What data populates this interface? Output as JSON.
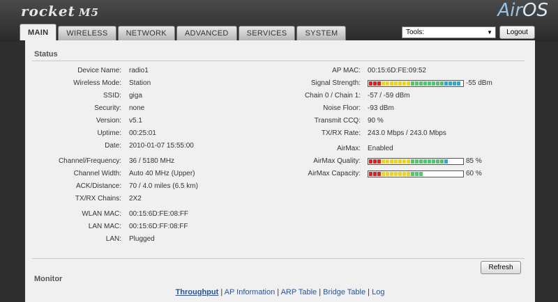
{
  "header": {
    "logo": "rocket",
    "model": "M5",
    "brand_air": "Air",
    "brand_os": "OS"
  },
  "tabs": [
    {
      "label": "MAIN"
    },
    {
      "label": "WIRELESS"
    },
    {
      "label": "NETWORK"
    },
    {
      "label": "ADVANCED"
    },
    {
      "label": "SERVICES"
    },
    {
      "label": "SYSTEM"
    }
  ],
  "tools": {
    "selected": "Tools:"
  },
  "logout_label": "Logout",
  "status": {
    "title": "Status",
    "left": [
      {
        "label": "Device Name:",
        "value": "radio1"
      },
      {
        "label": "Wireless Mode:",
        "value": "Station"
      },
      {
        "label": "SSID:",
        "value": "giga"
      },
      {
        "label": "Security:",
        "value": "none"
      },
      {
        "label": "Version:",
        "value": "v5.1"
      },
      {
        "label": "Uptime:",
        "value": "00:25:01"
      },
      {
        "label": "Date:",
        "value": "2010-01-07 15:55:00"
      },
      {
        "label": "Channel/Frequency:",
        "value": "36 / 5180 MHz"
      },
      {
        "label": "Channel Width:",
        "value": "Auto 40 MHz (Upper)"
      },
      {
        "label": "ACK/Distance:",
        "value": "70 / 4.0 miles (6.5 km)"
      },
      {
        "label": "TX/RX Chains:",
        "value": "2X2"
      },
      {
        "label": "WLAN MAC:",
        "value": "00:15:6D:FE:08:FF"
      },
      {
        "label": "LAN MAC:",
        "value": "00:15:6D:FF:08:FF"
      },
      {
        "label": "LAN:",
        "value": "Plugged"
      }
    ],
    "right": [
      {
        "label": "AP MAC:",
        "value": "00:15:6D:FE:09:52"
      },
      {
        "label": "Signal Strength:",
        "value": "-55 dBm",
        "level": 1.0
      },
      {
        "label": "Chain 0 / Chain 1:",
        "value": "-57 / -59 dBm"
      },
      {
        "label": "Noise Floor:",
        "value": "-93 dBm"
      },
      {
        "label": "Transmit CCQ:",
        "value": "90 %"
      },
      {
        "label": "TX/RX Rate:",
        "value": "243.0 Mbps  / 243.0 Mbps"
      },
      {
        "label": "AirMax:",
        "value": "Enabled"
      },
      {
        "label": "AirMax Quality:",
        "value": "85 %",
        "level": 0.85
      },
      {
        "label": "AirMax Capacity:",
        "value": "60 %",
        "level": 0.6
      }
    ]
  },
  "refresh_label": "Refresh",
  "monitor": {
    "title": "Monitor",
    "links": [
      "Throughput",
      "AP Information",
      "ARP Table",
      "Bridge Table",
      "Log"
    ],
    "separator": "|"
  },
  "colors": {
    "bar_low": "#e02020",
    "bar_mid": "#f0d020",
    "bar_high": "#50c870",
    "bar_top": "#30a8d0",
    "link": "#2255a4"
  }
}
